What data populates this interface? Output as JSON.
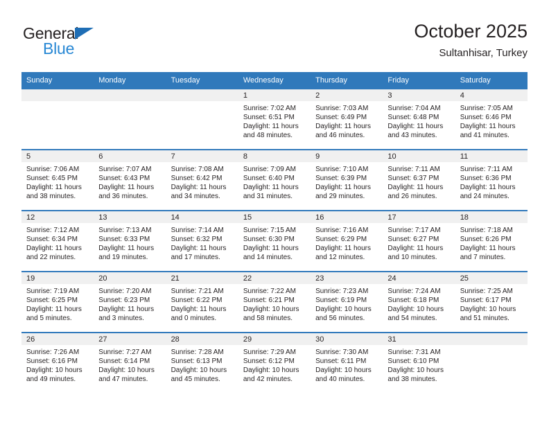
{
  "brand": {
    "name_top": "General",
    "name_bottom": "Blue",
    "color_dark": "#231f20",
    "color_blue": "#2787d4",
    "triangle_color": "#1f6eb5"
  },
  "header": {
    "title": "October 2025",
    "subtitle": "Sultanhisar, Turkey"
  },
  "theme": {
    "header_row_bg": "#3079bb",
    "day_band_bg": "#f0f0f0",
    "cell_bg": "#ffffff",
    "text": "#231f20"
  },
  "weekday_headers": [
    "Sunday",
    "Monday",
    "Tuesday",
    "Wednesday",
    "Thursday",
    "Friday",
    "Saturday"
  ],
  "weeks": [
    [
      {
        "day": "",
        "empty": true,
        "sunrise": "",
        "sunset": "",
        "daylight_line1": "",
        "daylight_line2": ""
      },
      {
        "day": "",
        "empty": true,
        "sunrise": "",
        "sunset": "",
        "daylight_line1": "",
        "daylight_line2": ""
      },
      {
        "day": "",
        "empty": true,
        "sunrise": "",
        "sunset": "",
        "daylight_line1": "",
        "daylight_line2": ""
      },
      {
        "day": "1",
        "empty": false,
        "sunrise": "Sunrise: 7:02 AM",
        "sunset": "Sunset: 6:51 PM",
        "daylight_line1": "Daylight: 11 hours",
        "daylight_line2": "and 48 minutes."
      },
      {
        "day": "2",
        "empty": false,
        "sunrise": "Sunrise: 7:03 AM",
        "sunset": "Sunset: 6:49 PM",
        "daylight_line1": "Daylight: 11 hours",
        "daylight_line2": "and 46 minutes."
      },
      {
        "day": "3",
        "empty": false,
        "sunrise": "Sunrise: 7:04 AM",
        "sunset": "Sunset: 6:48 PM",
        "daylight_line1": "Daylight: 11 hours",
        "daylight_line2": "and 43 minutes."
      },
      {
        "day": "4",
        "empty": false,
        "sunrise": "Sunrise: 7:05 AM",
        "sunset": "Sunset: 6:46 PM",
        "daylight_line1": "Daylight: 11 hours",
        "daylight_line2": "and 41 minutes."
      }
    ],
    [
      {
        "day": "5",
        "empty": false,
        "sunrise": "Sunrise: 7:06 AM",
        "sunset": "Sunset: 6:45 PM",
        "daylight_line1": "Daylight: 11 hours",
        "daylight_line2": "and 38 minutes."
      },
      {
        "day": "6",
        "empty": false,
        "sunrise": "Sunrise: 7:07 AM",
        "sunset": "Sunset: 6:43 PM",
        "daylight_line1": "Daylight: 11 hours",
        "daylight_line2": "and 36 minutes."
      },
      {
        "day": "7",
        "empty": false,
        "sunrise": "Sunrise: 7:08 AM",
        "sunset": "Sunset: 6:42 PM",
        "daylight_line1": "Daylight: 11 hours",
        "daylight_line2": "and 34 minutes."
      },
      {
        "day": "8",
        "empty": false,
        "sunrise": "Sunrise: 7:09 AM",
        "sunset": "Sunset: 6:40 PM",
        "daylight_line1": "Daylight: 11 hours",
        "daylight_line2": "and 31 minutes."
      },
      {
        "day": "9",
        "empty": false,
        "sunrise": "Sunrise: 7:10 AM",
        "sunset": "Sunset: 6:39 PM",
        "daylight_line1": "Daylight: 11 hours",
        "daylight_line2": "and 29 minutes."
      },
      {
        "day": "10",
        "empty": false,
        "sunrise": "Sunrise: 7:11 AM",
        "sunset": "Sunset: 6:37 PM",
        "daylight_line1": "Daylight: 11 hours",
        "daylight_line2": "and 26 minutes."
      },
      {
        "day": "11",
        "empty": false,
        "sunrise": "Sunrise: 7:11 AM",
        "sunset": "Sunset: 6:36 PM",
        "daylight_line1": "Daylight: 11 hours",
        "daylight_line2": "and 24 minutes."
      }
    ],
    [
      {
        "day": "12",
        "empty": false,
        "sunrise": "Sunrise: 7:12 AM",
        "sunset": "Sunset: 6:34 PM",
        "daylight_line1": "Daylight: 11 hours",
        "daylight_line2": "and 22 minutes."
      },
      {
        "day": "13",
        "empty": false,
        "sunrise": "Sunrise: 7:13 AM",
        "sunset": "Sunset: 6:33 PM",
        "daylight_line1": "Daylight: 11 hours",
        "daylight_line2": "and 19 minutes."
      },
      {
        "day": "14",
        "empty": false,
        "sunrise": "Sunrise: 7:14 AM",
        "sunset": "Sunset: 6:32 PM",
        "daylight_line1": "Daylight: 11 hours",
        "daylight_line2": "and 17 minutes."
      },
      {
        "day": "15",
        "empty": false,
        "sunrise": "Sunrise: 7:15 AM",
        "sunset": "Sunset: 6:30 PM",
        "daylight_line1": "Daylight: 11 hours",
        "daylight_line2": "and 14 minutes."
      },
      {
        "day": "16",
        "empty": false,
        "sunrise": "Sunrise: 7:16 AM",
        "sunset": "Sunset: 6:29 PM",
        "daylight_line1": "Daylight: 11 hours",
        "daylight_line2": "and 12 minutes."
      },
      {
        "day": "17",
        "empty": false,
        "sunrise": "Sunrise: 7:17 AM",
        "sunset": "Sunset: 6:27 PM",
        "daylight_line1": "Daylight: 11 hours",
        "daylight_line2": "and 10 minutes."
      },
      {
        "day": "18",
        "empty": false,
        "sunrise": "Sunrise: 7:18 AM",
        "sunset": "Sunset: 6:26 PM",
        "daylight_line1": "Daylight: 11 hours",
        "daylight_line2": "and 7 minutes."
      }
    ],
    [
      {
        "day": "19",
        "empty": false,
        "sunrise": "Sunrise: 7:19 AM",
        "sunset": "Sunset: 6:25 PM",
        "daylight_line1": "Daylight: 11 hours",
        "daylight_line2": "and 5 minutes."
      },
      {
        "day": "20",
        "empty": false,
        "sunrise": "Sunrise: 7:20 AM",
        "sunset": "Sunset: 6:23 PM",
        "daylight_line1": "Daylight: 11 hours",
        "daylight_line2": "and 3 minutes."
      },
      {
        "day": "21",
        "empty": false,
        "sunrise": "Sunrise: 7:21 AM",
        "sunset": "Sunset: 6:22 PM",
        "daylight_line1": "Daylight: 11 hours",
        "daylight_line2": "and 0 minutes."
      },
      {
        "day": "22",
        "empty": false,
        "sunrise": "Sunrise: 7:22 AM",
        "sunset": "Sunset: 6:21 PM",
        "daylight_line1": "Daylight: 10 hours",
        "daylight_line2": "and 58 minutes."
      },
      {
        "day": "23",
        "empty": false,
        "sunrise": "Sunrise: 7:23 AM",
        "sunset": "Sunset: 6:19 PM",
        "daylight_line1": "Daylight: 10 hours",
        "daylight_line2": "and 56 minutes."
      },
      {
        "day": "24",
        "empty": false,
        "sunrise": "Sunrise: 7:24 AM",
        "sunset": "Sunset: 6:18 PM",
        "daylight_line1": "Daylight: 10 hours",
        "daylight_line2": "and 54 minutes."
      },
      {
        "day": "25",
        "empty": false,
        "sunrise": "Sunrise: 7:25 AM",
        "sunset": "Sunset: 6:17 PM",
        "daylight_line1": "Daylight: 10 hours",
        "daylight_line2": "and 51 minutes."
      }
    ],
    [
      {
        "day": "26",
        "empty": false,
        "sunrise": "Sunrise: 7:26 AM",
        "sunset": "Sunset: 6:16 PM",
        "daylight_line1": "Daylight: 10 hours",
        "daylight_line2": "and 49 minutes."
      },
      {
        "day": "27",
        "empty": false,
        "sunrise": "Sunrise: 7:27 AM",
        "sunset": "Sunset: 6:14 PM",
        "daylight_line1": "Daylight: 10 hours",
        "daylight_line2": "and 47 minutes."
      },
      {
        "day": "28",
        "empty": false,
        "sunrise": "Sunrise: 7:28 AM",
        "sunset": "Sunset: 6:13 PM",
        "daylight_line1": "Daylight: 10 hours",
        "daylight_line2": "and 45 minutes."
      },
      {
        "day": "29",
        "empty": false,
        "sunrise": "Sunrise: 7:29 AM",
        "sunset": "Sunset: 6:12 PM",
        "daylight_line1": "Daylight: 10 hours",
        "daylight_line2": "and 42 minutes."
      },
      {
        "day": "30",
        "empty": false,
        "sunrise": "Sunrise: 7:30 AM",
        "sunset": "Sunset: 6:11 PM",
        "daylight_line1": "Daylight: 10 hours",
        "daylight_line2": "and 40 minutes."
      },
      {
        "day": "31",
        "empty": false,
        "sunrise": "Sunrise: 7:31 AM",
        "sunset": "Sunset: 6:10 PM",
        "daylight_line1": "Daylight: 10 hours",
        "daylight_line2": "and 38 minutes."
      },
      {
        "day": "",
        "empty": true,
        "sunrise": "",
        "sunset": "",
        "daylight_line1": "",
        "daylight_line2": ""
      }
    ]
  ]
}
